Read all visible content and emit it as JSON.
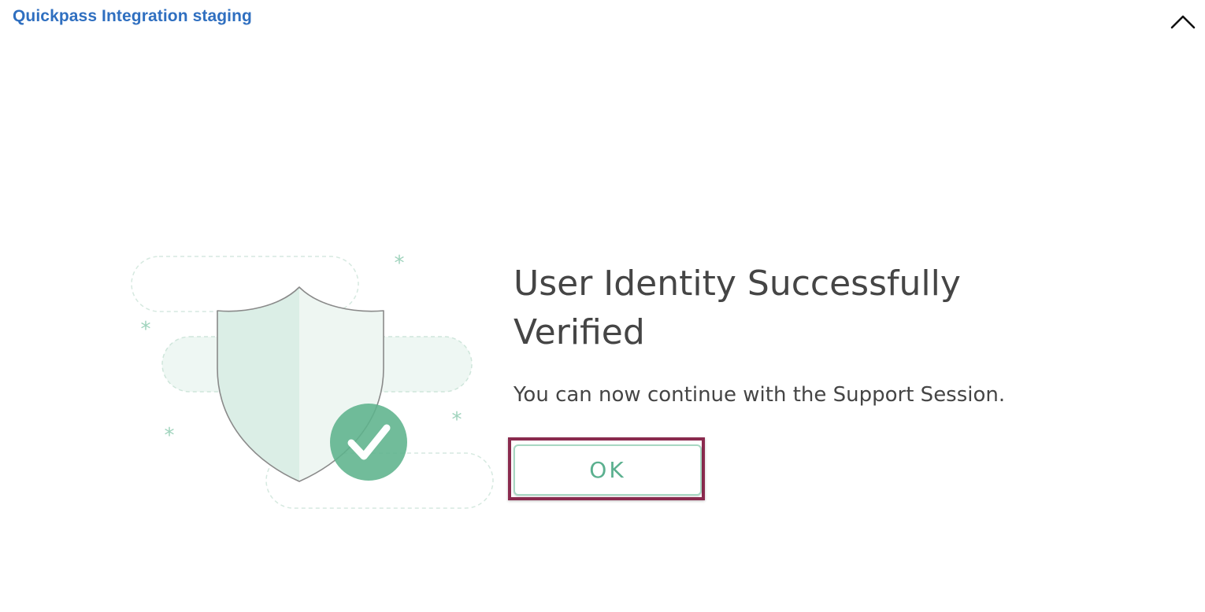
{
  "header": {
    "app_title": "Quickpass Integration staging",
    "collapse_icon": "chevron-up-icon"
  },
  "main": {
    "illustration_icon": "shield-check-icon",
    "headline": "User Identity Successfully Verified",
    "message": "You can now continue with the Support Session.",
    "ok_label": "OK"
  },
  "colors": {
    "title_blue": "#2f6fc0",
    "text_gray": "#454545",
    "accent_green": "#5bb08f",
    "highlight_border": "#8a2a4e"
  }
}
